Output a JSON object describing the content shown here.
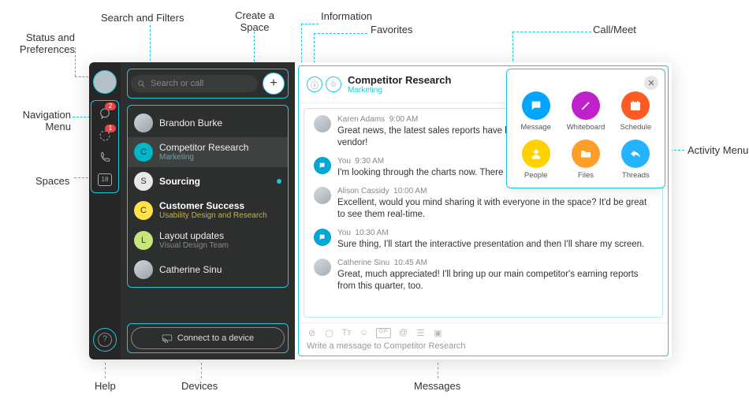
{
  "annotations": {
    "status_prefs": "Status and Preferences",
    "nav_menu": "Navigation Menu",
    "spaces": "Spaces",
    "help": "Help",
    "devices": "Devices",
    "search_filters": "Search and Filters",
    "create_space": "Create a Space",
    "information": "Information",
    "favorites": "Favorites",
    "messages": "Messages",
    "call_meet": "Call/Meet",
    "activity_menu": "Activity Menu"
  },
  "nav": {
    "chat_badge": "2",
    "team_badge": "1",
    "cal_day": "18"
  },
  "search": {
    "placeholder": "Search or call"
  },
  "devices": {
    "button": "Connect to a device"
  },
  "spaces": [
    {
      "name": "Brandon Burke",
      "sub": "",
      "av_bg": "#d0d4d8",
      "av_text": "",
      "bold": false,
      "active": false,
      "unread": false,
      "sub_color": "#888",
      "photo": true
    },
    {
      "name": "Competitor Research",
      "sub": "Marketing",
      "av_bg": "#00b6c9",
      "av_text": "C",
      "bold": false,
      "active": true,
      "unread": false,
      "sub_color": "#6aa0a6",
      "photo": false
    },
    {
      "name": "Sourcing",
      "sub": "",
      "av_bg": "#e8e8e8",
      "av_text": "S",
      "bold": true,
      "active": false,
      "unread": true,
      "sub_color": "#888",
      "photo": false
    },
    {
      "name": "Customer Success",
      "sub": "Usability Design and Research",
      "av_bg": "#ffe14a",
      "av_text": "C",
      "bold": true,
      "active": false,
      "unread": false,
      "sub_color": "#c4b04a",
      "photo": false
    },
    {
      "name": "Layout updates",
      "sub": "Visual Design Team",
      "av_bg": "#c6e67a",
      "av_text": "L",
      "bold": false,
      "active": false,
      "unread": false,
      "sub_color": "#888",
      "photo": false
    },
    {
      "name": "Catherine Sinu",
      "sub": "",
      "av_bg": "#c8cdd2",
      "av_text": "",
      "bold": false,
      "active": false,
      "unread": false,
      "sub_color": "#888",
      "photo": true
    }
  ],
  "header": {
    "title": "Competitor Research",
    "subtitle": "Marketing"
  },
  "messages": [
    {
      "author": "Karen Adams",
      "time": "9:00 AM",
      "text": "Great news, the latest sales reports have been submitted by our contracted vendor!",
      "self": false
    },
    {
      "author": "You",
      "time": "9:30 AM",
      "text": "I'm looking through the charts now. There is some great content here!",
      "self": true
    },
    {
      "author": "Alison Cassidy",
      "time": "10:00 AM",
      "text": "Excellent, would you mind sharing it with everyone in the space? It'd be great to see them real-time.",
      "self": false
    },
    {
      "author": "You",
      "time": "10:30 AM",
      "text": "Sure thing, I'll start the interactive presentation and then I'll share my screen.",
      "self": true
    },
    {
      "author": "Catherine Sinu",
      "time": "10:45 AM",
      "text": "Great, much appreciated! I'll bring up our main competitor's earning reports from this quarter, too.",
      "self": false
    }
  ],
  "composer": {
    "placeholder": "Write a message to Competitor Research"
  },
  "activity": [
    {
      "label": "Message",
      "color": "#00a6ff",
      "icon": "chat"
    },
    {
      "label": "Whiteboard",
      "color": "#c020c9",
      "icon": "pen"
    },
    {
      "label": "Schedule",
      "color": "#ff5a22",
      "icon": "cal"
    },
    {
      "label": "People",
      "color": "#ffd200",
      "icon": "person"
    },
    {
      "label": "Files",
      "color": "#ff9f29",
      "icon": "folder"
    },
    {
      "label": "Threads",
      "color": "#24b3ff",
      "icon": "reply"
    }
  ]
}
